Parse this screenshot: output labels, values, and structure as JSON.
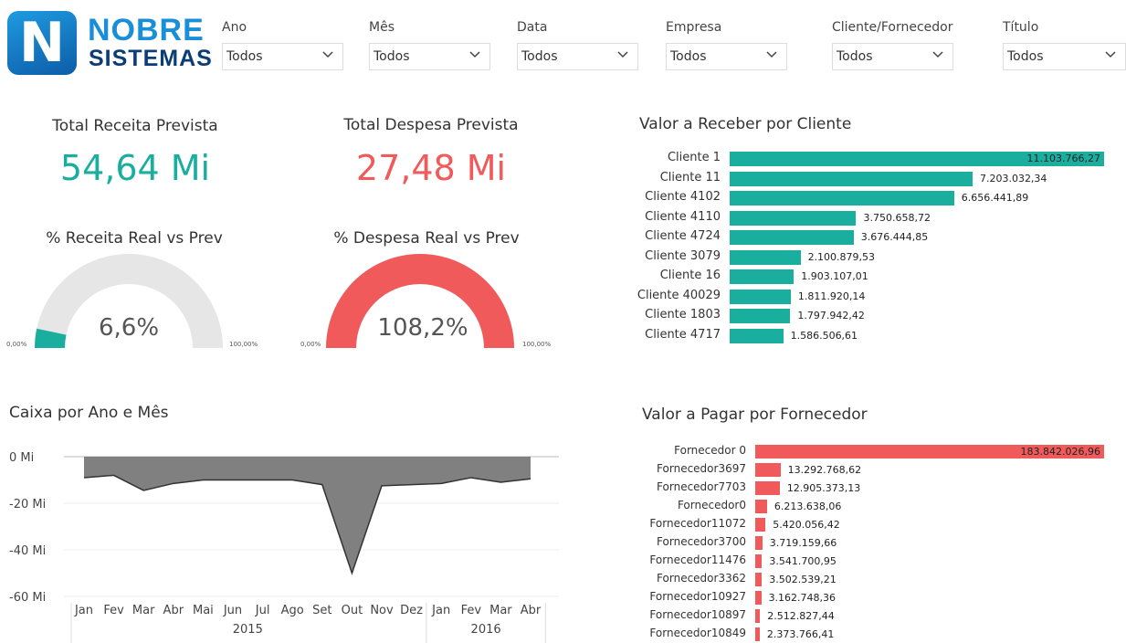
{
  "logo": {
    "line1": "NOBRE",
    "line2": "SISTEMAS",
    "letter": "N"
  },
  "filters": [
    {
      "label": "Ano",
      "value": "Todos"
    },
    {
      "label": "Mês",
      "value": "Todos"
    },
    {
      "label": "Data",
      "value": "Todos"
    },
    {
      "label": "Empresa",
      "value": "Todos"
    },
    {
      "label": "Cliente/Fornecedor",
      "value": "Todos"
    },
    {
      "label": "Título",
      "value": "Todos"
    }
  ],
  "kpis": {
    "receita": {
      "title": "Total Receita Prevista",
      "value": "54,64 Mi",
      "color": "#1aae9f"
    },
    "despesa": {
      "title": "Total Despesa Prevista",
      "value": "27,48 Mi",
      "color": "#f05a5b"
    }
  },
  "gauges": {
    "receita": {
      "title": "% Receita Real vs Prev",
      "value_label": "6,6%",
      "fraction": 0.066,
      "min": "0,00%",
      "max": "100,00%",
      "color": "#1aae9f"
    },
    "despesa": {
      "title": "% Despesa Real vs Prev",
      "value_label": "108,2%",
      "fraction": 1.0,
      "min": "0,00%",
      "max": "100,00%",
      "color": "#f05a5b"
    }
  },
  "receber": {
    "title": "Valor a Receber por Cliente",
    "color": "#1aae9f",
    "items": [
      {
        "label": "Cliente 1",
        "value": 11103766.27,
        "text": "11.103.766,27"
      },
      {
        "label": "Cliente 11",
        "value": 7203032.34,
        "text": "7.203.032,34"
      },
      {
        "label": "Cliente 4102",
        "value": 6656441.89,
        "text": "6.656.441,89"
      },
      {
        "label": "Cliente 4110",
        "value": 3750658.72,
        "text": "3.750.658,72"
      },
      {
        "label": "Cliente 4724",
        "value": 3676444.85,
        "text": "3.676.444,85"
      },
      {
        "label": "Cliente 3079",
        "value": 2100879.53,
        "text": "2.100.879,53"
      },
      {
        "label": "Cliente 16",
        "value": 1903107.01,
        "text": "1.903.107,01"
      },
      {
        "label": "Cliente 40029",
        "value": 1811920.14,
        "text": "1.811.920,14"
      },
      {
        "label": "Cliente 1803",
        "value": 1797942.42,
        "text": "1.797.942,42"
      },
      {
        "label": "Cliente 4717",
        "value": 1586506.61,
        "text": "1.586.506,61"
      }
    ]
  },
  "pagar": {
    "title": "Valor a Pagar por Fornecedor",
    "color": "#f05a5b",
    "items": [
      {
        "label": "Fornecedor 0",
        "value": 183842026.96,
        "text": "183.842.026,96"
      },
      {
        "label": "Fornecedor3697",
        "value": 13292768.62,
        "text": "13.292.768,62"
      },
      {
        "label": "Fornecedor7703",
        "value": 12905373.13,
        "text": "12.905.373,13"
      },
      {
        "label": "Fornecedor0",
        "value": 6213638.06,
        "text": "6.213.638,06"
      },
      {
        "label": "Fornecedor11072",
        "value": 5420056.42,
        "text": "5.420.056,42"
      },
      {
        "label": "Fornecedor3700",
        "value": 3719159.66,
        "text": "3.719.159,66"
      },
      {
        "label": "Fornecedor11476",
        "value": 3541700.95,
        "text": "3.541.700,95"
      },
      {
        "label": "Fornecedor3362",
        "value": 3502539.21,
        "text": "3.502.539,21"
      },
      {
        "label": "Fornecedor10927",
        "value": 3162748.36,
        "text": "3.162.748,36"
      },
      {
        "label": "Fornecedor10897",
        "value": 2512827.44,
        "text": "2.512.827,44"
      },
      {
        "label": "Fornecedor10849",
        "value": 2373766.41,
        "text": "2.373.766,41"
      }
    ]
  },
  "chart_data": {
    "type": "area",
    "title": "Caixa por Ano e Mês",
    "x": [
      "Jan",
      "Fev",
      "Mar",
      "Abr",
      "Mai",
      "Jun",
      "Jul",
      "Ago",
      "Set",
      "Out",
      "Nov",
      "Dez",
      "Jan",
      "Fev",
      "Mar",
      "Abr"
    ],
    "groups": [
      {
        "label": "2015",
        "count": 12
      },
      {
        "label": "2016",
        "count": 4
      }
    ],
    "values": [
      -9,
      -8,
      -14.5,
      -11.5,
      -10,
      -10,
      -10,
      -10,
      -12,
      -50,
      -12.5,
      -12,
      -11.5,
      -9,
      -11,
      -9.5
    ],
    "ylim": [
      -60,
      0
    ],
    "yticks": [
      0,
      -20,
      -40,
      -60
    ],
    "ytick_labels": [
      "0 Mi",
      "-20 Mi",
      "-40 Mi",
      "-60 Mi"
    ],
    "fill_color": "#808080",
    "line_color": "#333333"
  }
}
